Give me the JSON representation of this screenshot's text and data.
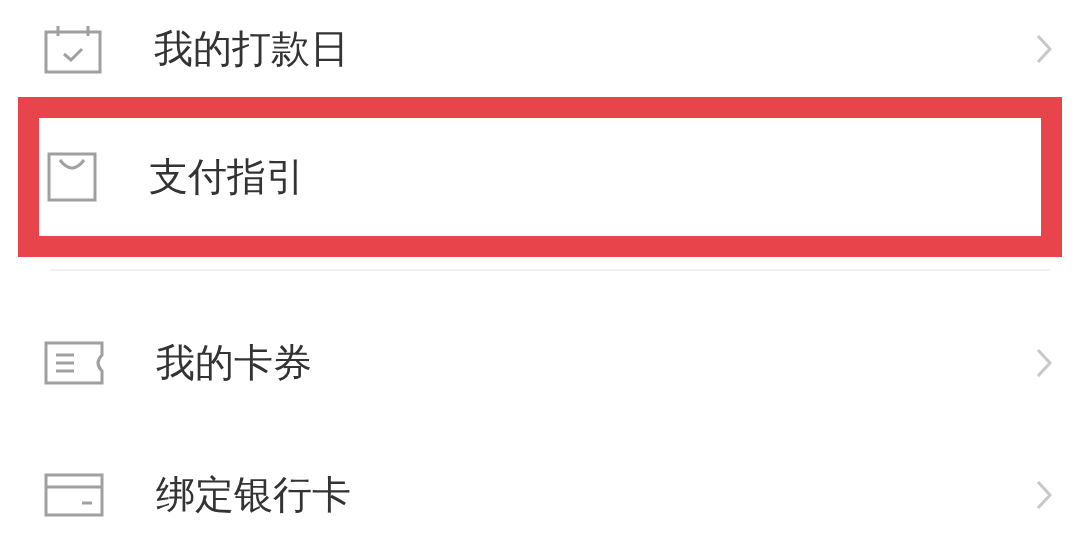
{
  "menu": [
    {
      "label": "我的打款日",
      "kind": "calendar",
      "highlighted": false
    },
    {
      "label": "支付指引",
      "kind": "bag",
      "highlighted": true
    },
    {
      "label": "我的卡券",
      "kind": "ticket",
      "highlighted": false
    },
    {
      "label": "绑定银行卡",
      "kind": "card",
      "highlighted": false
    }
  ]
}
